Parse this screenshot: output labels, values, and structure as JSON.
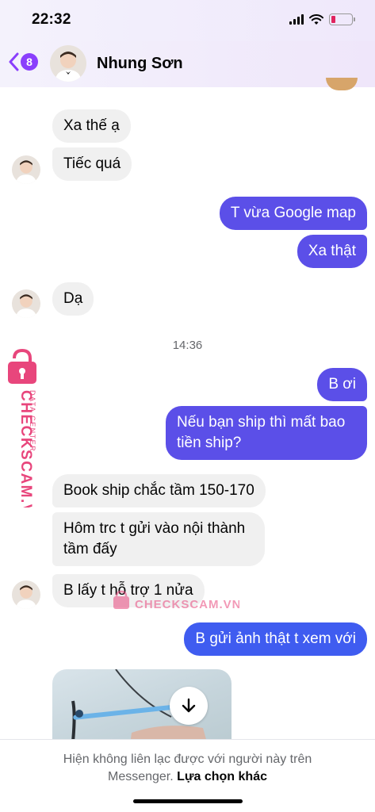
{
  "status_bar": {
    "time": "22:32",
    "signal_icon": "signal-icon",
    "wifi_icon": "wifi-icon",
    "battery_icon": "battery-low-icon"
  },
  "header": {
    "back_icon": "chevron-left-icon",
    "unread_count": "8",
    "contact_name": "Nhung Sơn",
    "accent": "#8a3ffc"
  },
  "colors": {
    "outgoing_bubble": "#5b4fe8",
    "incoming_bubble": "#f0f0f0",
    "watermark": "#e8467c"
  },
  "messages": [
    {
      "dir": "in",
      "text": "Xa thế ạ"
    },
    {
      "dir": "in",
      "text": "Tiếc quá"
    },
    {
      "dir": "out",
      "text": "T vừa Google map"
    },
    {
      "dir": "out",
      "text": "Xa thật"
    },
    {
      "dir": "in",
      "text": "Dạ"
    },
    {
      "dir": "time",
      "text": "14:36"
    },
    {
      "dir": "out",
      "text": "B ơi"
    },
    {
      "dir": "out",
      "text": "Nếu bạn ship thì mất bao tiền ship?"
    },
    {
      "dir": "in",
      "text": "Book ship chắc tầm 150-170"
    },
    {
      "dir": "in",
      "text": "Hôm trc t gửi vào nội thành tầm đấy"
    },
    {
      "dir": "in",
      "text": "B lấy t hỗ trợ 1 nửa"
    },
    {
      "dir": "out",
      "text": "B gửi ảnh thật t xem với"
    }
  ],
  "photo_message": {
    "download_icon": "download-arrow-icon"
  },
  "watermark": {
    "brand": "CHECKSCAM.VN",
    "sub": "DATA CENTER",
    "center_text": "CHECKSCAM.VN",
    "icon": "lock-icon"
  },
  "footer": {
    "notice": "Hiện không liên lạc được với người này trên Messenger.",
    "link": "Lựa chọn khác"
  }
}
